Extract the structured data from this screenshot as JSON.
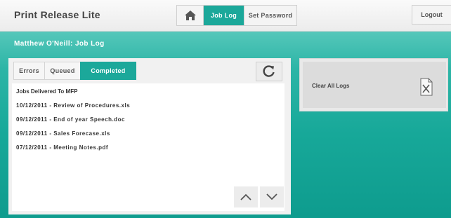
{
  "header": {
    "app_title": "Print Release Lite",
    "nav": {
      "home_icon": "home-icon",
      "job_log_label": "Job Log",
      "set_password_label": "Set Password"
    },
    "logout_label": "Logout"
  },
  "page": {
    "heading": "Matthew O'Neill: Job Log"
  },
  "job_panel": {
    "tabs": [
      {
        "label": "Errors",
        "active": false
      },
      {
        "label": "Queued",
        "active": false
      },
      {
        "label": "Completed",
        "active": true
      }
    ],
    "refresh_icon": "refresh-icon",
    "list_heading": "Jobs Delivered To MFP",
    "jobs": [
      "10/12/2011 - Review of Procedures.xls",
      "09/12/2011 - End of year Speech.doc",
      "09/12/2011 - Sales Forecase.xls",
      "07/12/2011 - Meeting Notes.pdf"
    ],
    "scroll_up_icon": "chevron-up-icon",
    "scroll_down_icon": "chevron-down-icon"
  },
  "side_panel": {
    "clear_logs_label": "Clear All Logs",
    "clear_icon": "clear-document-icon"
  },
  "colors": {
    "accent": "#1ba89a",
    "background_teal": "#17a899"
  }
}
